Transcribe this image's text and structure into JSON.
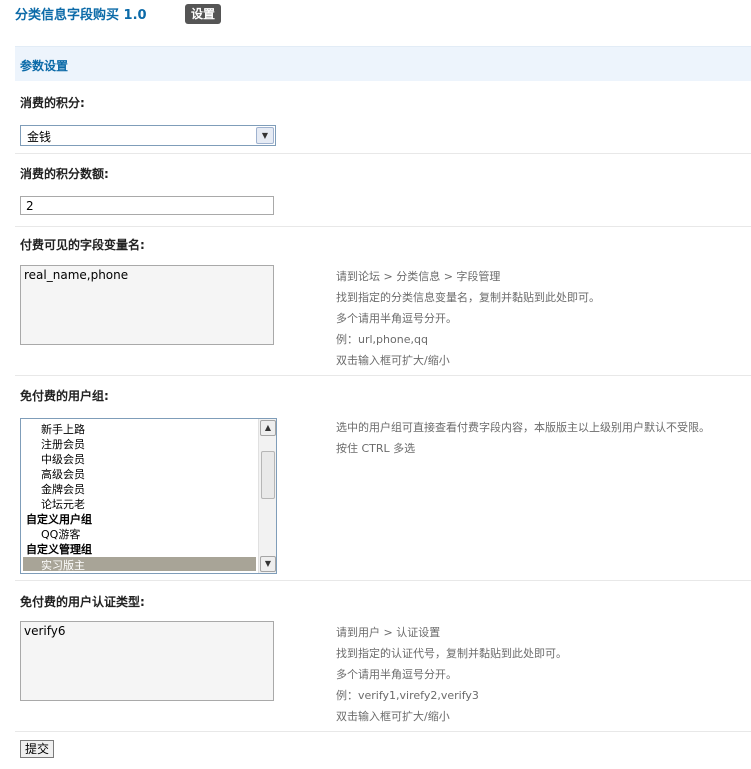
{
  "header": {
    "title": "分类信息字段购买 1.0",
    "badge": "设置"
  },
  "section": {
    "title": "参数设置"
  },
  "fields": {
    "credit_type": {
      "label": "消费的积分:",
      "selected": "金钱"
    },
    "credit_amount": {
      "label": "消费的积分数额:",
      "value": "2"
    },
    "paid_fields": {
      "label": "付费可见的字段变量名:",
      "value": "real_name,phone",
      "hints": [
        "请到论坛 > 分类信息 > 字段管理",
        "找到指定的分类信息变量名，复制并黏贴到此处即可。",
        "多个请用半角逗号分开。",
        "例：url,phone,qq",
        "双击输入框可扩大/缩小"
      ]
    },
    "free_groups": {
      "label": "免付费的用户组:",
      "options": [
        {
          "text": "新手上路",
          "kind": "opt"
        },
        {
          "text": "注册会员",
          "kind": "opt"
        },
        {
          "text": "中级会员",
          "kind": "opt"
        },
        {
          "text": "高级会员",
          "kind": "opt"
        },
        {
          "text": "金牌会员",
          "kind": "opt"
        },
        {
          "text": "论坛元老",
          "kind": "opt"
        },
        {
          "text": "自定义用户组",
          "kind": "group"
        },
        {
          "text": "QQ游客",
          "kind": "opt"
        },
        {
          "text": "自定义管理组",
          "kind": "group"
        }
      ],
      "selected": "实习版主",
      "hints": [
        "选中的用户组可直接查看付费字段内容，本版版主以上级别用户默认不受限。",
        "按住 CTRL 多选"
      ]
    },
    "free_verify": {
      "label": "免付费的用户认证类型:",
      "value": "verify6",
      "hints": [
        "请到用户 > 认证设置",
        "找到指定的认证代号，复制并黏贴到此处即可。",
        "多个请用半角逗号分开。",
        "例：verify1,virefy2,verify3",
        "双击输入框可扩大/缩小"
      ]
    }
  },
  "submit_label": "提交"
}
